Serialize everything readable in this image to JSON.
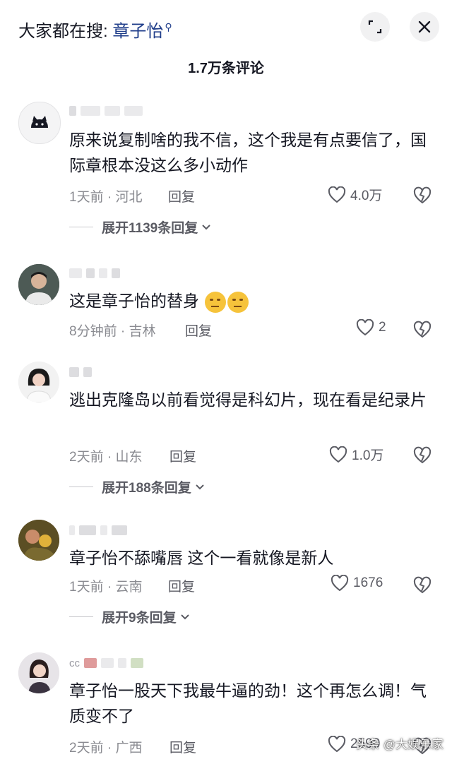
{
  "header": {
    "search_prefix": "大家都在搜: ",
    "search_keyword": "章子怡",
    "comment_count": "1.7万条评论"
  },
  "comments": [
    {
      "text": "原来说复制啥的我不信，这个我是有点要信了，国际章根本没这么多小动作",
      "time": "1天前",
      "location": "河北",
      "reply_label": "回复",
      "likes": "4.0万",
      "expand": "展开1139条回复"
    },
    {
      "text": "这是章子怡的替身",
      "time": "8分钟前",
      "location": "吉林",
      "reply_label": "回复",
      "likes": "2",
      "expand": ""
    },
    {
      "text": "逃出克隆岛以前看觉得是科幻片，现在看是纪录片",
      "time": "2天前",
      "location": "山东",
      "reply_label": "回复",
      "likes": "1.0万",
      "expand": "展开188条回复"
    },
    {
      "text": "章子怡不舔嘴唇 这个一看就像是新人",
      "time": "1天前",
      "location": "云南",
      "reply_label": "回复",
      "likes": "1676",
      "expand": "展开9条回复"
    },
    {
      "username_visible": "cc",
      "text": "章子怡一股天下我最牛逼的劲！这个再怎么调！气质变不了",
      "time": "2天前",
      "location": "广西",
      "reply_label": "回复",
      "likes": "2590",
      "expand": ""
    }
  ],
  "watermark": "头条 @大娱乐家",
  "colors": {
    "keyword": "#1f3d8a",
    "text": "#161823",
    "meta": "#8a8b91"
  }
}
